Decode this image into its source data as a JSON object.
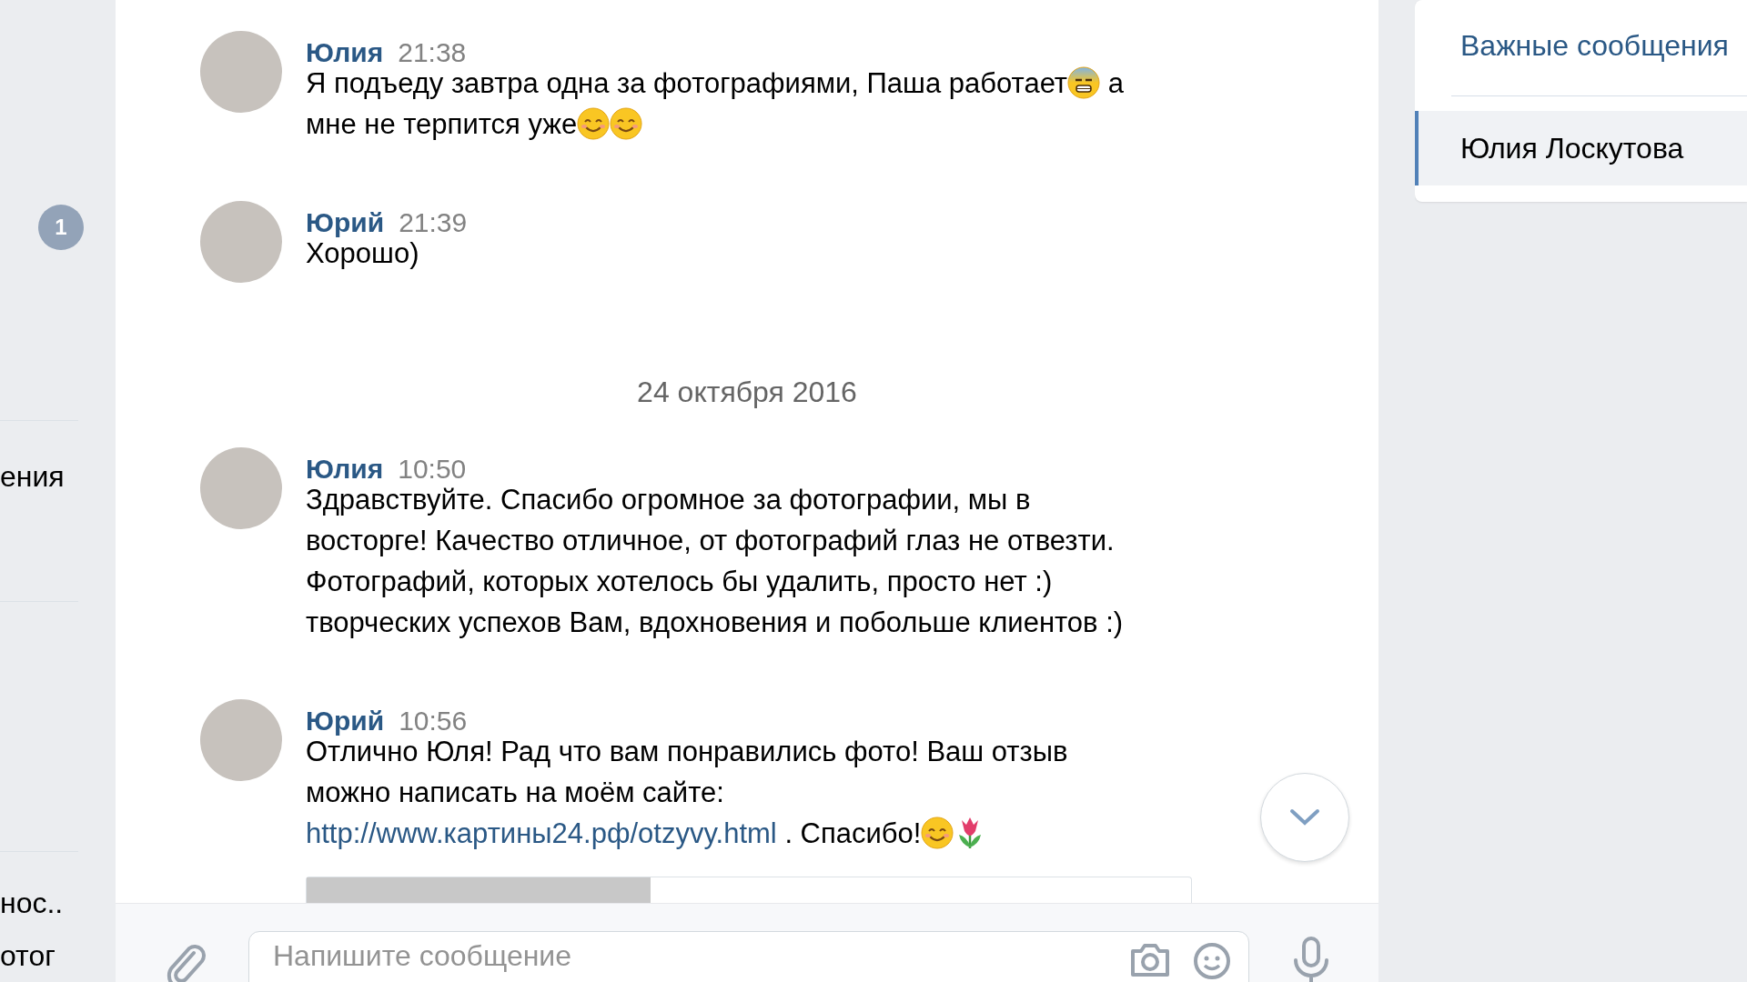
{
  "left_panel": {
    "unread_badge": "1",
    "label": "ения",
    "last_item_lines": [
      "нос..",
      "отог"
    ]
  },
  "chat": {
    "items": [
      {
        "kind": "message",
        "sender": "Юлия",
        "time": "21:38",
        "lines": [
          [
            {
              "kind": "text",
              "text": "Я подъеду завтра одна за фотографиями, Паша работает"
            },
            {
              "kind": "anxious-emoji"
            },
            {
              "kind": "text",
              "text": " а"
            }
          ],
          [
            {
              "kind": "text",
              "text": "мне не терпится уже"
            },
            {
              "kind": "smile-emoji"
            },
            {
              "kind": "smile-emoji"
            }
          ]
        ]
      },
      {
        "kind": "message",
        "sender": "Юрий",
        "time": "21:39",
        "lines": [
          [
            {
              "kind": "text",
              "text": "Хорошо)"
            }
          ]
        ]
      },
      {
        "kind": "date",
        "text": "24 октября 2016"
      },
      {
        "kind": "message",
        "sender": "Юлия",
        "time": "10:50",
        "lines": [
          [
            {
              "kind": "text",
              "text": "Здравствуйте. Спасибо огромное за фотографии, мы в"
            }
          ],
          [
            {
              "kind": "text",
              "text": "восторге! Качество отличное, от фотографий глаз не отвезти."
            }
          ],
          [
            {
              "kind": "text",
              "text": "Фотографий, которых хотелось бы удалить, просто нет :)"
            }
          ],
          [
            {
              "kind": "text",
              "text": "творческих успехов Вам, вдохновения и побольше клиентов :)"
            }
          ]
        ]
      },
      {
        "kind": "message",
        "sender": "Юрий",
        "time": "10:56",
        "link_preview": true,
        "lines": [
          [
            {
              "kind": "text",
              "text": "Отлично Юля! Рад что вам понравились фото! Ваш отзыв"
            }
          ],
          [
            {
              "kind": "text",
              "text": "можно написать на моём сайте:"
            }
          ],
          [
            {
              "kind": "link",
              "text": "http://www.картины24.рф/otzyvy.html"
            },
            {
              "kind": "text",
              "text": " . Спасибо!"
            },
            {
              "kind": "smile-emoji"
            },
            {
              "kind": "tulip-emoji"
            }
          ]
        ]
      }
    ]
  },
  "composer": {
    "placeholder": "Напишите сообщение"
  },
  "right_panel": {
    "items": [
      {
        "label": "Важные сообщения",
        "selected": false
      },
      {
        "label": "Юлия Лоскутова",
        "selected": true
      }
    ]
  }
}
